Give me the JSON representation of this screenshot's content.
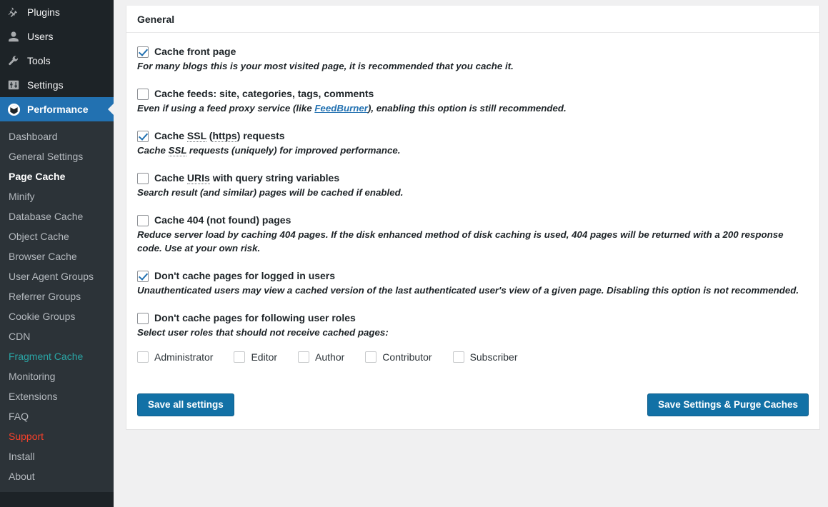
{
  "sidebar": {
    "top_items": [
      {
        "label": "Plugins",
        "icon": "plug-icon",
        "active": false
      },
      {
        "label": "Users",
        "icon": "user-icon",
        "active": false
      },
      {
        "label": "Tools",
        "icon": "wrench-icon",
        "active": false
      },
      {
        "label": "Settings",
        "icon": "sliders-icon",
        "active": false
      },
      {
        "label": "Performance",
        "icon": "cube-icon",
        "active": true
      }
    ],
    "submenu_items": [
      {
        "label": "Dashboard",
        "state": "normal"
      },
      {
        "label": "General Settings",
        "state": "normal"
      },
      {
        "label": "Page Cache",
        "state": "current"
      },
      {
        "label": "Minify",
        "state": "normal"
      },
      {
        "label": "Database Cache",
        "state": "normal"
      },
      {
        "label": "Object Cache",
        "state": "normal"
      },
      {
        "label": "Browser Cache",
        "state": "normal"
      },
      {
        "label": "User Agent Groups",
        "state": "normal"
      },
      {
        "label": "Referrer Groups",
        "state": "normal"
      },
      {
        "label": "Cookie Groups",
        "state": "normal"
      },
      {
        "label": "CDN",
        "state": "normal"
      },
      {
        "label": "Fragment Cache",
        "state": "teal"
      },
      {
        "label": "Monitoring",
        "state": "normal"
      },
      {
        "label": "Extensions",
        "state": "normal"
      },
      {
        "label": "FAQ",
        "state": "normal"
      },
      {
        "label": "Support",
        "state": "red"
      },
      {
        "label": "Install",
        "state": "normal"
      },
      {
        "label": "About",
        "state": "normal"
      }
    ]
  },
  "panel": {
    "title": "General"
  },
  "options": [
    {
      "label": "Cache front page",
      "checked": true,
      "desc": "For many blogs this is your most visited page, it is recommended that you cache it."
    },
    {
      "label": "Cache feeds: site, categories, tags, comments",
      "checked": false,
      "desc_pre": "Even if using a feed proxy service (like ",
      "link": "FeedBurner",
      "desc_post": "), enabling this option is still recommended."
    },
    {
      "label_pre": "Cache ",
      "abbr1": "SSL",
      "label_mid": " (",
      "abbr2": "https",
      "label_post": ") requests",
      "checked": true,
      "desc_pre": "Cache ",
      "desc_abbr": "SSL",
      "desc_post": " requests (uniquely) for improved performance."
    },
    {
      "label_pre": "Cache ",
      "abbr": "URIs",
      "label_post": " with query string variables",
      "checked": false,
      "desc": "Search result (and similar) pages will be cached if enabled."
    },
    {
      "label": "Cache 404 (not found) pages",
      "checked": false,
      "desc": "Reduce server load by caching 404 pages. If the disk enhanced method of disk caching is used, 404 pages will be returned with a 200 response code. Use at your own risk."
    },
    {
      "label": "Don't cache pages for logged in users",
      "checked": true,
      "desc": "Unauthenticated users may view a cached version of the last authenticated user's view of a given page. Disabling this option is not recommended."
    },
    {
      "label": "Don't cache pages for following user roles",
      "checked": false,
      "desc": "Select user roles that should not receive cached pages:"
    }
  ],
  "roles": [
    {
      "label": "Administrator",
      "checked": false
    },
    {
      "label": "Editor",
      "checked": false
    },
    {
      "label": "Author",
      "checked": false
    },
    {
      "label": "Contributor",
      "checked": false
    },
    {
      "label": "Subscriber",
      "checked": false
    }
  ],
  "buttons": {
    "save_all": "Save all settings",
    "save_purge": "Save Settings & Purge Caches"
  },
  "colors": {
    "sidebar_bg": "#1d2327",
    "submenu_bg": "#2c3338",
    "accent": "#2271b1",
    "button": "#1271a6",
    "teal": "#2aa5a5",
    "red": "#f6402a"
  }
}
